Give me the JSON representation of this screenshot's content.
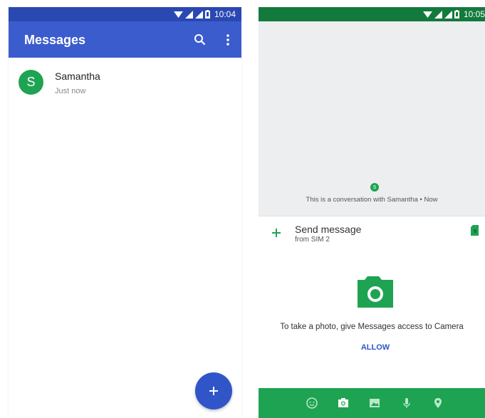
{
  "left_screen": {
    "status_time": "10:04",
    "app_title": "Messages",
    "conversation": {
      "avatar_letter": "S",
      "name": "Samantha",
      "time": "Just now"
    },
    "fab_icon": "plus-icon"
  },
  "right_screen": {
    "status_time": "10:05",
    "avatar_letter": "S",
    "conversation_info": "This is a conversation with Samantha • Now",
    "compose_placeholder": "Send message",
    "compose_sim": "from SIM 2",
    "camera_permission_text": "To take a photo, give Messages access to Camera",
    "allow_button": "ALLOW",
    "media_bar_icons": [
      "sticker-icon",
      "camera-icon",
      "gallery-icon",
      "mic-icon",
      "location-icon"
    ]
  },
  "colors": {
    "primary_blue": "#3b5ccd",
    "status_blue": "#2a48b2",
    "accent_green": "#1ea353",
    "status_green": "#127a3d"
  }
}
